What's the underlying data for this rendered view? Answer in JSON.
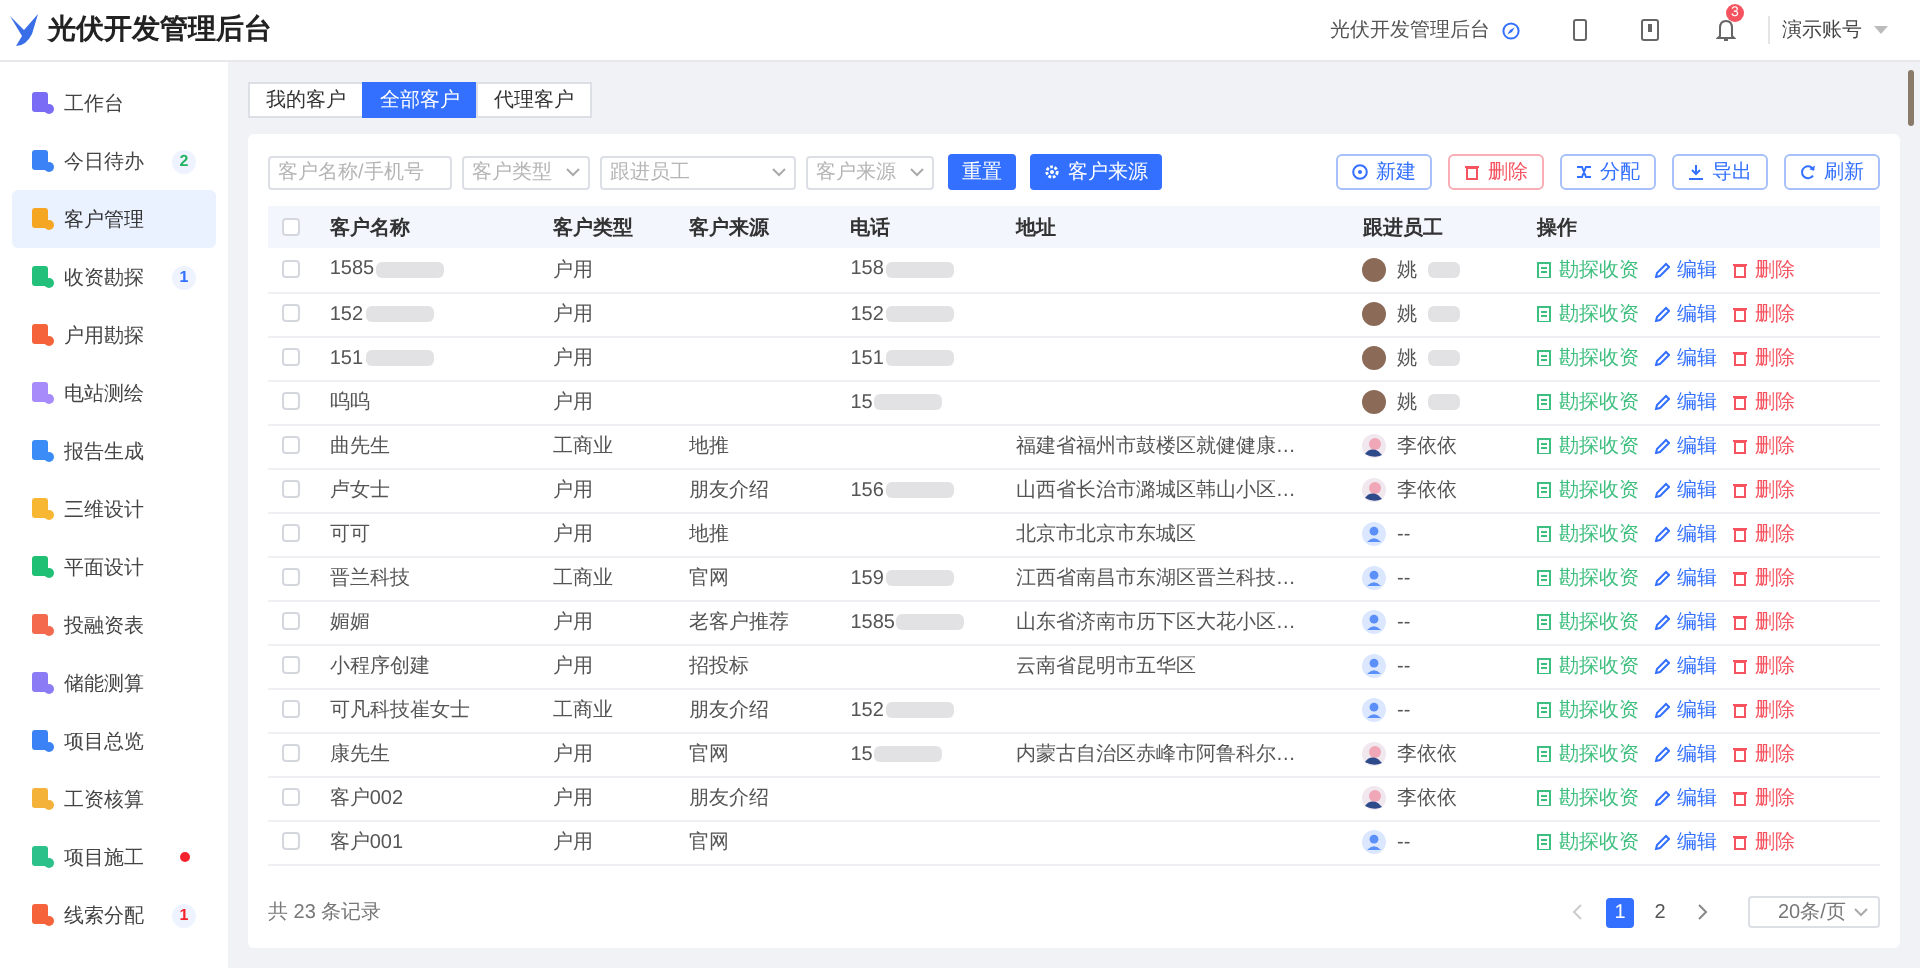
{
  "header": {
    "title": "光伏开发管理后台",
    "system_link": "光伏开发管理后台",
    "notification_count": "3",
    "account": "演示账号"
  },
  "sidebar": {
    "items": [
      {
        "label": "工作台",
        "selected": false,
        "color": "#7b6cf6"
      },
      {
        "label": "今日待办",
        "selected": false,
        "color": "#3b82f6",
        "badge": {
          "kind": "count",
          "text": "2",
          "color": "#22b35e"
        }
      },
      {
        "label": "客户管理",
        "selected": true,
        "color": "#f5a623"
      },
      {
        "label": "收资勘探",
        "selected": false,
        "color": "#22c07a",
        "badge": {
          "kind": "count",
          "text": "1",
          "color": "#3370ff"
        }
      },
      {
        "label": "户用勘探",
        "selected": false,
        "color": "#f5633a"
      },
      {
        "label": "电站测绘",
        "selected": false,
        "color": "#a78bfa"
      },
      {
        "label": "报告生成",
        "selected": false,
        "color": "#3b8cf6"
      },
      {
        "label": "三维设计",
        "selected": false,
        "color": "#f7b733"
      },
      {
        "label": "平面设计",
        "selected": false,
        "color": "#1fbf74"
      },
      {
        "label": "投融资表",
        "selected": false,
        "color": "#f46a4e"
      },
      {
        "label": "储能测算",
        "selected": false,
        "color": "#8b7cf6"
      },
      {
        "label": "项目总览",
        "selected": false,
        "color": "#3b82f6"
      },
      {
        "label": "工资核算",
        "selected": false,
        "color": "#f5b23a"
      },
      {
        "label": "项目施工",
        "selected": false,
        "color": "#2cc08a",
        "badge": {
          "kind": "dot",
          "color": "#f5222d"
        }
      },
      {
        "label": "线索分配",
        "selected": false,
        "color": "#f5633a",
        "badge": {
          "kind": "count",
          "text": "1",
          "color": "#f5222d"
        }
      }
    ]
  },
  "tabs": [
    {
      "label": "我的客户",
      "selected": false
    },
    {
      "label": "全部客户",
      "selected": true
    },
    {
      "label": "代理客户",
      "selected": false
    }
  ],
  "filters": {
    "search": {
      "placeholder": "客户名称/手机号"
    },
    "selects": [
      {
        "placeholder": "客户类型"
      },
      {
        "placeholder": "跟进员工"
      },
      {
        "placeholder": "客户来源"
      }
    ],
    "buttons": [
      {
        "label": "重置",
        "kind": "text"
      },
      {
        "label": "客户来源",
        "kind": "settings"
      }
    ]
  },
  "toolbar": [
    {
      "label": "新建",
      "kind": "add"
    },
    {
      "label": "删除",
      "kind": "delete"
    },
    {
      "label": "分配",
      "kind": "assign"
    },
    {
      "label": "导出",
      "kind": "export"
    },
    {
      "label": "刷新",
      "kind": "refresh"
    }
  ],
  "table": {
    "all_checked": false,
    "columns": [
      "客户名称",
      "客户类型",
      "客户来源",
      "电话",
      "地址",
      "跟进员工",
      "操作"
    ],
    "rows": [
      {
        "checked": false,
        "name": "1585",
        "name_masked": true,
        "type": "户用",
        "source": "",
        "phone": "158",
        "phone_masked": true,
        "address": "",
        "employee": {
          "kind": "photo",
          "name": "姚",
          "masked": true
        },
        "actions": [
          {
            "label": "勘探收资",
            "kind": "survey"
          },
          {
            "label": "编辑",
            "kind": "edit"
          },
          {
            "label": "删除",
            "kind": "delete"
          }
        ]
      },
      {
        "checked": false,
        "name": "152",
        "name_masked": true,
        "type": "户用",
        "source": "",
        "phone": "152",
        "phone_masked": true,
        "address": "",
        "employee": {
          "kind": "photo",
          "name": "姚",
          "masked": true
        },
        "actions": [
          {
            "label": "勘探收资",
            "kind": "survey"
          },
          {
            "label": "编辑",
            "kind": "edit"
          },
          {
            "label": "删除",
            "kind": "delete"
          }
        ]
      },
      {
        "checked": false,
        "name": "151",
        "name_masked": true,
        "type": "户用",
        "source": "",
        "phone": "151",
        "phone_masked": true,
        "address": "",
        "employee": {
          "kind": "photo",
          "name": "姚",
          "masked": true
        },
        "actions": [
          {
            "label": "勘探收资",
            "kind": "survey"
          },
          {
            "label": "编辑",
            "kind": "edit"
          },
          {
            "label": "删除",
            "kind": "delete"
          }
        ]
      },
      {
        "checked": false,
        "name": "呜呜",
        "name_masked": false,
        "type": "户用",
        "source": "",
        "phone": "15",
        "phone_masked": true,
        "address": "",
        "employee": {
          "kind": "photo",
          "name": "姚",
          "masked": true
        },
        "actions": [
          {
            "label": "勘探收资",
            "kind": "survey"
          },
          {
            "label": "编辑",
            "kind": "edit"
          },
          {
            "label": "删除",
            "kind": "delete"
          }
        ]
      },
      {
        "checked": false,
        "name": "曲先生",
        "name_masked": false,
        "type": "工商业",
        "source": "地推",
        "phone": "",
        "phone_masked": false,
        "address": "福建省福州市鼓楼区就健健康…",
        "employee": {
          "kind": "illustration",
          "name": "李依依",
          "masked": false
        },
        "actions": [
          {
            "label": "勘探收资",
            "kind": "survey"
          },
          {
            "label": "编辑",
            "kind": "edit"
          },
          {
            "label": "删除",
            "kind": "delete"
          }
        ]
      },
      {
        "checked": false,
        "name": "卢女士",
        "name_masked": false,
        "type": "户用",
        "source": "朋友介绍",
        "phone": "156",
        "phone_masked": true,
        "address": "山西省长治市潞城区韩山小区…",
        "employee": {
          "kind": "illustration",
          "name": "李依依",
          "masked": false
        },
        "actions": [
          {
            "label": "勘探收资",
            "kind": "survey"
          },
          {
            "label": "编辑",
            "kind": "edit"
          },
          {
            "label": "删除",
            "kind": "delete"
          }
        ]
      },
      {
        "checked": false,
        "name": "可可",
        "name_masked": false,
        "type": "户用",
        "source": "地推",
        "phone": "",
        "phone_masked": false,
        "address": "北京市北京市东城区",
        "employee": {
          "kind": "default",
          "name": "--",
          "masked": false
        },
        "actions": [
          {
            "label": "勘探收资",
            "kind": "survey"
          },
          {
            "label": "编辑",
            "kind": "edit"
          },
          {
            "label": "删除",
            "kind": "delete"
          }
        ]
      },
      {
        "checked": false,
        "name": "晋兰科技",
        "name_masked": false,
        "type": "工商业",
        "source": "官网",
        "phone": "159",
        "phone_masked": true,
        "address": "江西省南昌市东湖区晋兰科技…",
        "employee": {
          "kind": "default",
          "name": "--",
          "masked": false
        },
        "actions": [
          {
            "label": "勘探收资",
            "kind": "survey"
          },
          {
            "label": "编辑",
            "kind": "edit"
          },
          {
            "label": "删除",
            "kind": "delete"
          }
        ]
      },
      {
        "checked": false,
        "name": "媚媚",
        "name_masked": false,
        "type": "户用",
        "source": "老客户推荐",
        "phone": "1585",
        "phone_masked": true,
        "address": "山东省济南市历下区大花小区…",
        "employee": {
          "kind": "default",
          "name": "--",
          "masked": false
        },
        "actions": [
          {
            "label": "勘探收资",
            "kind": "survey"
          },
          {
            "label": "编辑",
            "kind": "edit"
          },
          {
            "label": "删除",
            "kind": "delete"
          }
        ]
      },
      {
        "checked": false,
        "name": "小程序创建",
        "name_masked": false,
        "type": "户用",
        "source": "招投标",
        "phone": "",
        "phone_masked": false,
        "address": "云南省昆明市五华区",
        "employee": {
          "kind": "default",
          "name": "--",
          "masked": false
        },
        "actions": [
          {
            "label": "勘探收资",
            "kind": "survey"
          },
          {
            "label": "编辑",
            "kind": "edit"
          },
          {
            "label": "删除",
            "kind": "delete"
          }
        ]
      },
      {
        "checked": false,
        "name": "可凡科技崔女士",
        "name_masked": false,
        "type": "工商业",
        "source": "朋友介绍",
        "phone": "152",
        "phone_masked": true,
        "address": "",
        "employee": {
          "kind": "default",
          "name": "--",
          "masked": false
        },
        "actions": [
          {
            "label": "勘探收资",
            "kind": "survey"
          },
          {
            "label": "编辑",
            "kind": "edit"
          },
          {
            "label": "删除",
            "kind": "delete"
          }
        ]
      },
      {
        "checked": false,
        "name": "康先生",
        "name_masked": false,
        "type": "户用",
        "source": "官网",
        "phone": "15",
        "phone_masked": true,
        "address": "内蒙古自治区赤峰市阿鲁科尔…",
        "employee": {
          "kind": "illustration",
          "name": "李依依",
          "masked": false
        },
        "actions": [
          {
            "label": "勘探收资",
            "kind": "survey"
          },
          {
            "label": "编辑",
            "kind": "edit"
          },
          {
            "label": "删除",
            "kind": "delete"
          }
        ]
      },
      {
        "checked": false,
        "name": "客户002",
        "name_masked": false,
        "type": "户用",
        "source": "朋友介绍",
        "phone": "",
        "phone_masked": false,
        "address": "",
        "employee": {
          "kind": "illustration",
          "name": "李依依",
          "masked": false
        },
        "actions": [
          {
            "label": "勘探收资",
            "kind": "survey"
          },
          {
            "label": "编辑",
            "kind": "edit"
          },
          {
            "label": "删除",
            "kind": "delete"
          }
        ]
      },
      {
        "checked": false,
        "name": "客户001",
        "name_masked": false,
        "type": "户用",
        "source": "官网",
        "phone": "",
        "phone_masked": false,
        "address": "",
        "employee": {
          "kind": "default",
          "name": "--",
          "masked": false
        },
        "actions": [
          {
            "label": "勘探收资",
            "kind": "survey"
          },
          {
            "label": "编辑",
            "kind": "edit"
          },
          {
            "label": "删除",
            "kind": "delete"
          }
        ]
      }
    ]
  },
  "footer": {
    "total": "共 23 条记录",
    "pages": [
      {
        "label": "1",
        "selected": true
      },
      {
        "label": "2",
        "selected": false
      }
    ],
    "page_size": "20条/页"
  }
}
